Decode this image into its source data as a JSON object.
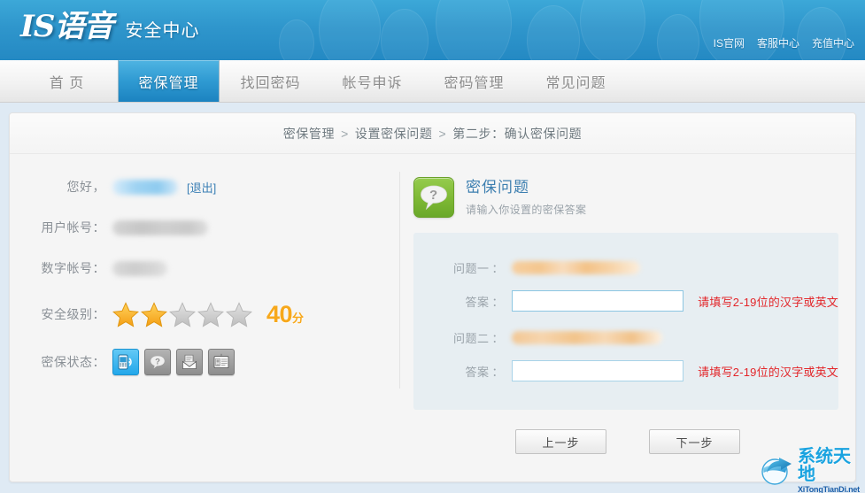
{
  "header": {
    "logo_main": "IS语音",
    "logo_sub": "安全中心",
    "top_links": [
      {
        "label": "IS官网"
      },
      {
        "label": "客服中心"
      },
      {
        "label": "充值中心"
      }
    ]
  },
  "nav": {
    "items": [
      {
        "label": "首 页",
        "active": false
      },
      {
        "label": "密保管理",
        "active": true
      },
      {
        "label": "找回密码",
        "active": false
      },
      {
        "label": "帐号申诉",
        "active": false
      },
      {
        "label": "密码管理",
        "active": false
      },
      {
        "label": "常见问题",
        "active": false
      }
    ]
  },
  "breadcrumb": {
    "item1": "密保管理",
    "sep1": ">",
    "item2": "设置密保问题",
    "sep2": ">",
    "item3": "第二步：确认密保问题"
  },
  "account": {
    "greeting_label": "您好，",
    "nickname_masked": "",
    "logout_label": "[退出]",
    "user_account_label": "用户帐号：",
    "user_account_masked": "",
    "digit_account_label": "数字帐号：",
    "digit_account_masked": "",
    "security_level_label": "安全级别：",
    "stars_total": 5,
    "stars_filled": 2,
    "score": "40",
    "score_unit": "分",
    "status_label": "密保状态：",
    "status_icons": [
      {
        "name": "mobile-icon",
        "active": true
      },
      {
        "name": "question-icon",
        "active": false
      },
      {
        "name": "mail-icon",
        "active": false
      },
      {
        "name": "id-card-icon",
        "active": false
      }
    ]
  },
  "question_panel": {
    "title": "密保问题",
    "desc": "请输入你设置的密保答案",
    "rows": [
      {
        "question_label": "问题一",
        "question_colon": "：",
        "question_masked": "",
        "answer_label": "答案",
        "answer_colon": "：",
        "answer_value": "",
        "answer_placeholder": "",
        "hint": "请填写2-19位的汉字或英文",
        "focused": true
      },
      {
        "question_label": "问题二",
        "question_colon": "：",
        "question_masked": "",
        "answer_label": "答案",
        "answer_colon": "：",
        "answer_value": "",
        "answer_placeholder": "",
        "hint": "请填写2-19位的汉字或英文",
        "focused": false
      }
    ]
  },
  "buttons": {
    "prev": "上一步",
    "next": "下一步"
  },
  "watermark": {
    "cn": "系统天地",
    "en": "XiTongTianDi.net"
  },
  "colors": {
    "header_blue": "#2f96cc",
    "active_tab": "#2f9ad2",
    "link_blue": "#3a7fb5",
    "hint_red": "#e3262a",
    "score_orange": "#f7a81b",
    "icon_green": "#7db834",
    "page_bg": "#dfeaf4",
    "panel_bg": "#e7eef2"
  }
}
